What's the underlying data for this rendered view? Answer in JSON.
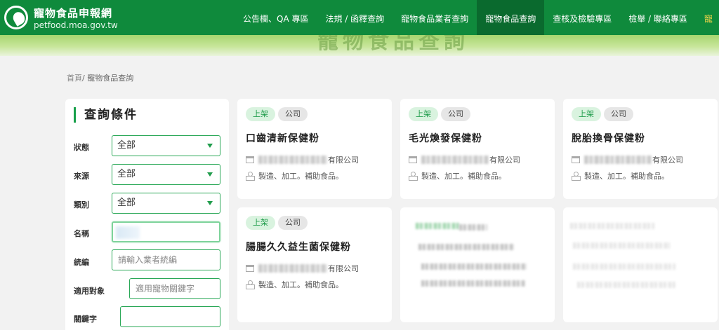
{
  "header": {
    "site_title": "寵物食品申報網",
    "site_domain": "petfood.moa.gov.tw",
    "nav": [
      {
        "label": "公告欄、QA 專區"
      },
      {
        "label": "法規 / 函釋查詢"
      },
      {
        "label": "寵物食品業者查詢"
      },
      {
        "label": "寵物食品查詢",
        "active": true
      },
      {
        "label": "查核及檢驗專區"
      },
      {
        "label": "檢舉 / 聯絡專區"
      },
      {
        "label": "寵"
      }
    ]
  },
  "banner": {
    "text": "寵物食品查詢"
  },
  "breadcrumb": {
    "home": "首頁",
    "separator": "/",
    "current": "寵物食品查詢"
  },
  "filter": {
    "title": "查詢條件",
    "status": {
      "label": "狀態",
      "value": "全部"
    },
    "source": {
      "label": "來源",
      "value": "全部"
    },
    "category": {
      "label": "類別",
      "value": "全部"
    },
    "name": {
      "label": "名稱",
      "value": ""
    },
    "tax_id": {
      "label": "統編",
      "placeholder": "請輸入業者統編"
    },
    "target": {
      "label": "適用對象",
      "placeholder": "適用寵物關鍵字"
    },
    "keyword": {
      "label": "關鍵字",
      "value": ""
    }
  },
  "cards": [
    {
      "status": "上架",
      "type": "公司",
      "name": "口齒清新保健粉",
      "company_suffix": "有限公司",
      "category": "製造、加工。補助食品。"
    },
    {
      "status": "上架",
      "type": "公司",
      "name": "毛光煥發保健粉",
      "company_suffix": "有限公司",
      "category": "製造、加工。補助食品。"
    },
    {
      "status": "上架",
      "type": "公司",
      "name": "脫胎換骨保健粉",
      "company_suffix": "有限公司",
      "category": "製造、加工。補助食品。"
    },
    {
      "status": "上架",
      "type": "公司",
      "name": "腸腸久久益生菌保健粉",
      "company_suffix": "有限公司",
      "category": "製造、加工。補助食品。"
    }
  ],
  "colors": {
    "brand_green": "#0f8a3c",
    "active_nav": "#0a6a2e",
    "accent": "#1f9c4b",
    "tag_on_bg": "#d9f3df",
    "tag_co_bg": "#e6e6e6"
  },
  "icons": {
    "logo": "leaf-logo-icon",
    "company": "building-icon",
    "category": "category-icon",
    "dropdown": "triangle-down-icon"
  }
}
